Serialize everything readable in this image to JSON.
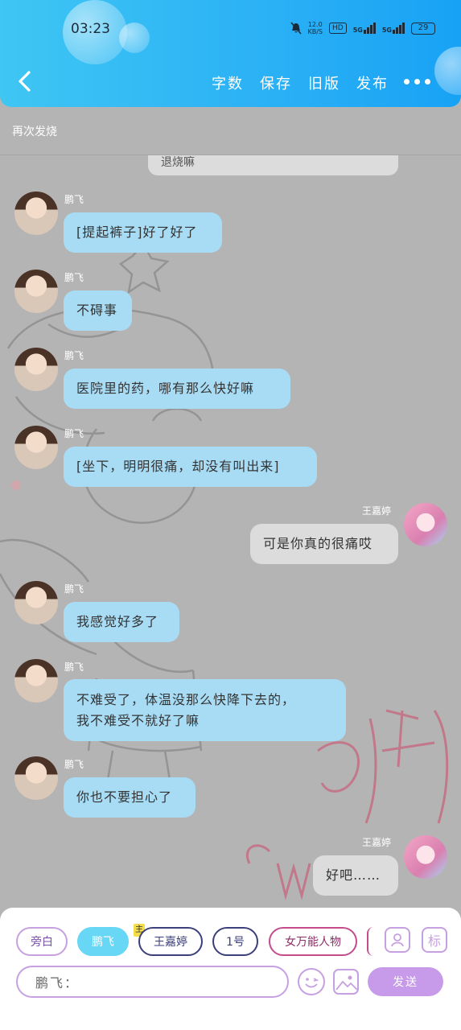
{
  "status_bar": {
    "time": "03:23",
    "net_speed": "12.0\nKB/S",
    "hd": "HD",
    "signal1": "5G",
    "signal2": "5G",
    "battery": "29"
  },
  "header": {
    "menu": [
      "字数",
      "保存",
      "旧版",
      "发布"
    ]
  },
  "title": "再次发烧",
  "top_partial_message": "退烧嘛",
  "messages": [
    {
      "side": "left",
      "name": "鹏飞",
      "lines": [
        "[提起裤子]好了好了"
      ]
    },
    {
      "side": "left",
      "name": "鹏飞",
      "lines": [
        "不碍事"
      ]
    },
    {
      "side": "left",
      "name": "鹏飞",
      "lines": [
        "医院里的药，哪有那么快好嘛"
      ]
    },
    {
      "side": "left",
      "name": "鹏飞",
      "lines": [
        "[坐下，明明很痛，却没有叫出来]"
      ]
    },
    {
      "side": "right",
      "name": "王嘉婷",
      "lines": [
        "可是你真的很痛哎"
      ]
    },
    {
      "side": "left",
      "name": "鹏飞",
      "lines": [
        "我感觉好多了"
      ]
    },
    {
      "side": "left",
      "name": "鹏飞",
      "lines": [
        "不难受了，体温没那么快降下去的，",
        "我不难受不就好了嘛"
      ]
    },
    {
      "side": "left",
      "name": "鹏飞",
      "lines": [
        "你也不要担心了"
      ]
    },
    {
      "side": "right",
      "name": "王嘉婷",
      "lines": [
        "好吧……"
      ]
    }
  ],
  "roles": {
    "chips": [
      "旁白",
      "鹏飞",
      "王嘉婷",
      "1号",
      "女万能人物"
    ],
    "selected": "鹏飞",
    "main_badge": "主",
    "tag_icon": "标"
  },
  "composer": {
    "prefix": "鹏飞：",
    "send_label": "发送"
  },
  "colors": {
    "header": "#2ab0f5",
    "bubble_left": "#a8dcf5",
    "bubble_right": "#dcdcdc",
    "accent": "#c79bea"
  }
}
